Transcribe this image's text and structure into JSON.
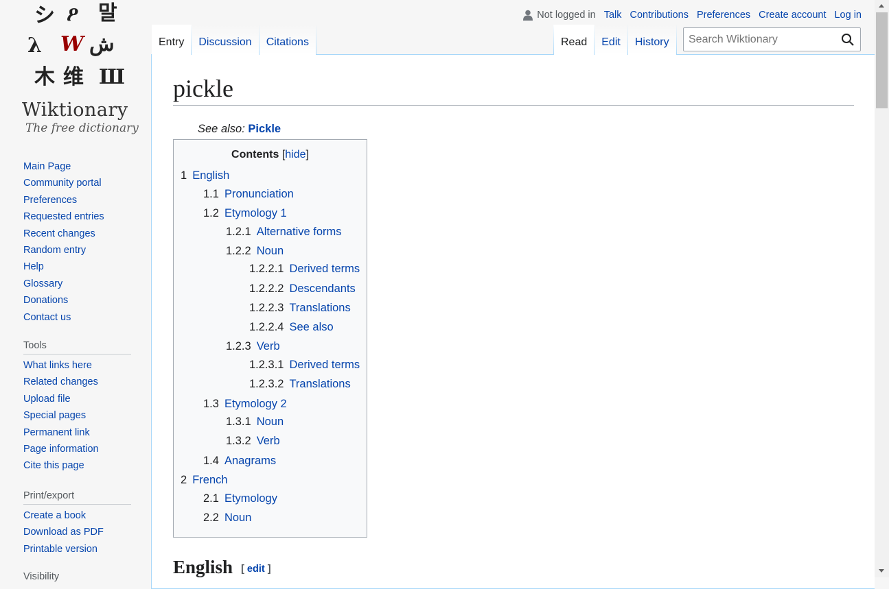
{
  "logo": {
    "glyphs": [
      "シ",
      "ዖ",
      "말",
      "λ",
      "W",
      "ش",
      "木",
      "维",
      "Ш"
    ],
    "wordmark": "Wiktionary",
    "tagline": "The free dictionary"
  },
  "navigation": {
    "items": [
      "Main Page",
      "Community portal",
      "Preferences",
      "Requested entries",
      "Recent changes",
      "Random entry",
      "Help",
      "Glossary",
      "Donations",
      "Contact us"
    ]
  },
  "tools": {
    "heading": "Tools",
    "items": [
      "What links here",
      "Related changes",
      "Upload file",
      "Special pages",
      "Permanent link",
      "Page information",
      "Cite this page"
    ]
  },
  "print_export": {
    "heading": "Print/export",
    "items": [
      "Create a book",
      "Download as PDF",
      "Printable version"
    ]
  },
  "partial_heading": "Visibility",
  "personal": {
    "user_label": "Not logged in",
    "links": [
      "Talk",
      "Contributions",
      "Preferences",
      "Create account",
      "Log in"
    ]
  },
  "tabs": {
    "left": [
      "Entry",
      "Discussion",
      "Citations"
    ],
    "right": [
      "Read",
      "Edit",
      "History"
    ]
  },
  "search": {
    "placeholder": "Search Wiktionary"
  },
  "page": {
    "title": "pickle",
    "see_also_label": "See also:",
    "see_also_link": "Pickle"
  },
  "toc": {
    "title": "Contents",
    "toggle": "hide",
    "items": [
      {
        "num": "1",
        "label": "English"
      },
      {
        "num": "1.1",
        "label": "Pronunciation"
      },
      {
        "num": "1.2",
        "label": "Etymology 1"
      },
      {
        "num": "1.2.1",
        "label": "Alternative forms"
      },
      {
        "num": "1.2.2",
        "label": "Noun"
      },
      {
        "num": "1.2.2.1",
        "label": "Derived terms"
      },
      {
        "num": "1.2.2.2",
        "label": "Descendants"
      },
      {
        "num": "1.2.2.3",
        "label": "Translations"
      },
      {
        "num": "1.2.2.4",
        "label": "See also"
      },
      {
        "num": "1.2.3",
        "label": "Verb"
      },
      {
        "num": "1.2.3.1",
        "label": "Derived terms"
      },
      {
        "num": "1.2.3.2",
        "label": "Translations"
      },
      {
        "num": "1.3",
        "label": "Etymology 2"
      },
      {
        "num": "1.3.1",
        "label": "Noun"
      },
      {
        "num": "1.3.2",
        "label": "Verb"
      },
      {
        "num": "1.4",
        "label": "Anagrams"
      },
      {
        "num": "2",
        "label": "French"
      },
      {
        "num": "2.1",
        "label": "Etymology"
      },
      {
        "num": "2.2",
        "label": "Noun"
      }
    ]
  },
  "section": {
    "heading": "English",
    "edit_label": "edit"
  },
  "colors": {
    "link": "#0645ad",
    "logo_accent": "#990000",
    "border": "#a7d7f9"
  }
}
